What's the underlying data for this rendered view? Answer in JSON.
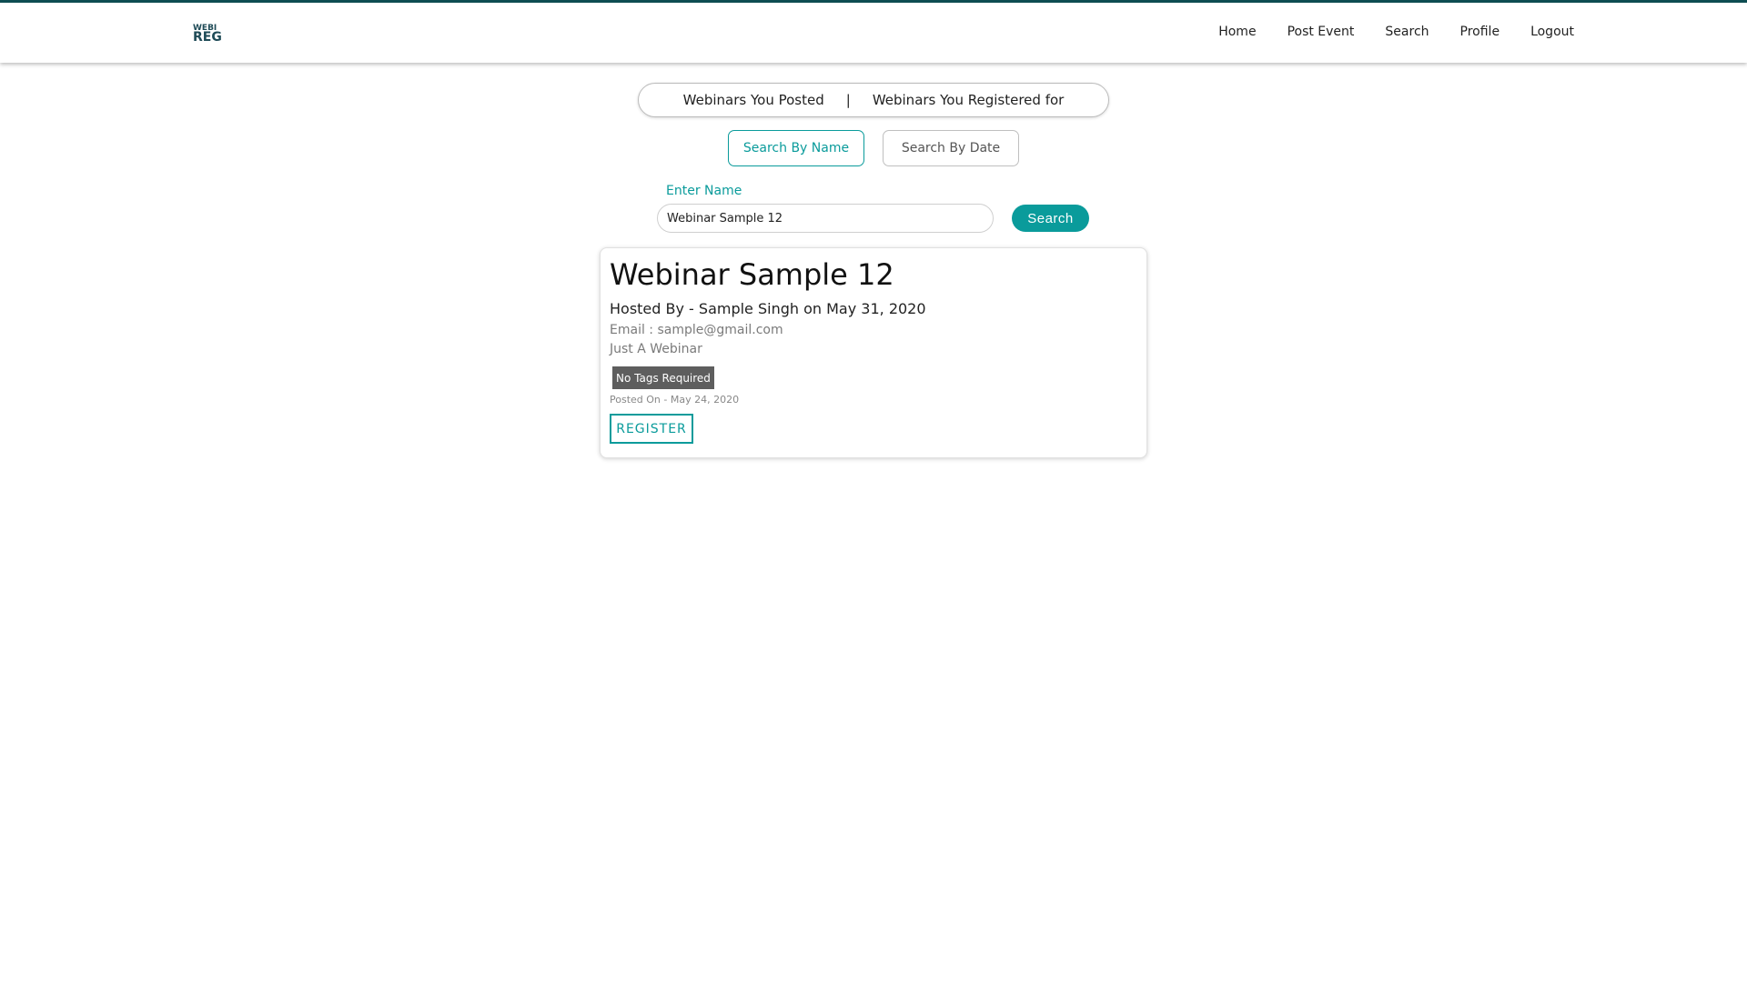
{
  "brand": {
    "logo_line1": "WEBI",
    "logo_line2": "REG"
  },
  "nav": {
    "items": [
      "Home",
      "Post Event",
      "Search",
      "Profile",
      "Logout"
    ]
  },
  "toggle": {
    "posted": "Webinars You Posted",
    "separator": "|",
    "registered": "Webinars You Registered for"
  },
  "search_modes": {
    "by_name": "Search By Name",
    "by_date": "Search By Date",
    "active": "by_name"
  },
  "search_form": {
    "label": "Enter Name",
    "value": "Webinar Sample 12",
    "button": "Search"
  },
  "result": {
    "title": "Webinar Sample 12",
    "hosted": "Hosted By - Sample Singh on May 31, 2020",
    "email": "Email : sample@gmail.com",
    "description": "Just A Webinar",
    "tag": "No Tags Required",
    "posted": "Posted On - May 24, 2020",
    "register_label": "REGISTER"
  },
  "colors": {
    "accent": "#0a9b9b",
    "navbar_border": "#0e4d52",
    "tag_bg": "#5e5e5e"
  }
}
